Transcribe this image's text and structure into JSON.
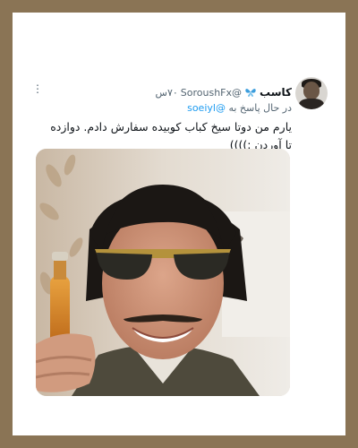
{
  "tweet": {
    "display_name": "کاسب",
    "handle": "@SoroushFx",
    "time": "۷۰س",
    "replying_prefix": "در حال پاسخ به",
    "replying_to": "@soeiyl",
    "text": "یارم من دوتا سیخ کباب کوبیده سفارش دادم. دوازده تا آوردن :))))",
    "more_icon": "more-options-icon",
    "badge_icon": "blue-butterfly-icon"
  },
  "colors": {
    "frame_border": "#8a7455",
    "link": "#1d9bf0",
    "secondary_text": "#536471",
    "primary_text": "#0f1419"
  }
}
